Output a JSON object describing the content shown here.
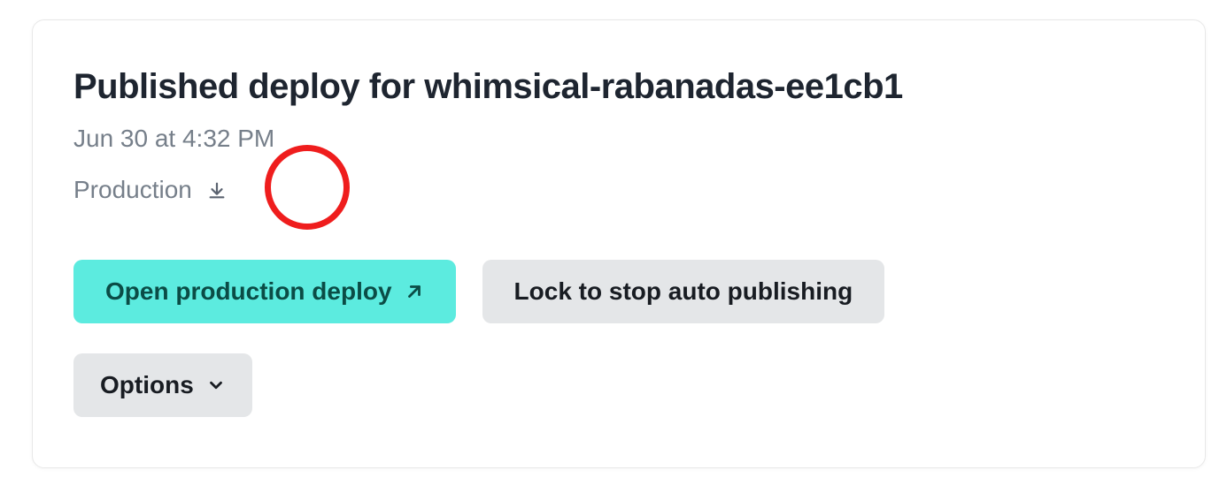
{
  "header": {
    "title": "Published deploy for whimsical-rabanadas-ee1cb1",
    "timestamp": "Jun 30 at 4:32 PM",
    "environment": "Production"
  },
  "actions": {
    "open_deploy_label": "Open production deploy",
    "lock_label": "Lock to stop auto publishing",
    "options_label": "Options"
  },
  "colors": {
    "accent": "#5cebdf",
    "secondary_bg": "#e4e6e8",
    "text_dark": "#1e2530",
    "text_muted": "#767f8a",
    "annotation": "#ef1d1d"
  }
}
